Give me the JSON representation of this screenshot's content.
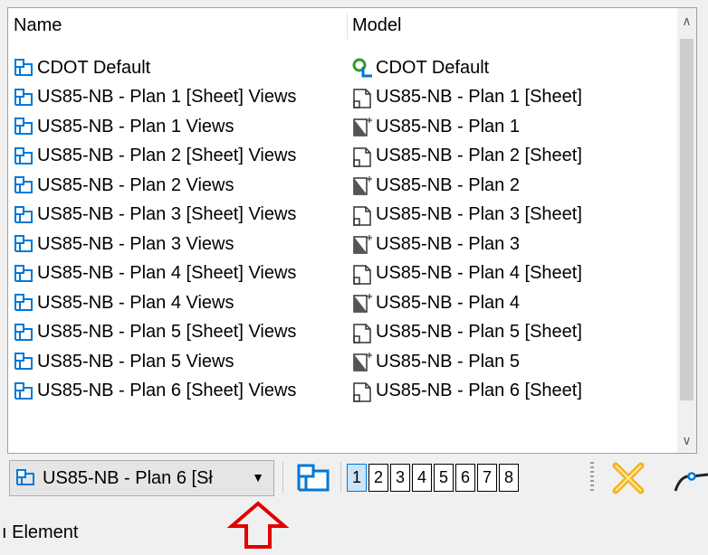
{
  "list": {
    "headers": {
      "name": "Name",
      "model": "Model"
    },
    "rows": [
      {
        "name": "CDOT Default",
        "model": "CDOT Default",
        "model_icon": "default-model-icon"
      },
      {
        "name": "US85-NB - Plan 1 [Sheet] Views",
        "model": "US85-NB - Plan 1 [Sheet]",
        "model_icon": "sheet-model-icon"
      },
      {
        "name": "US85-NB - Plan 1 Views",
        "model": "US85-NB - Plan 1",
        "model_icon": "design-model-icon"
      },
      {
        "name": "US85-NB - Plan 2 [Sheet] Views",
        "model": "US85-NB - Plan 2 [Sheet]",
        "model_icon": "sheet-model-icon"
      },
      {
        "name": "US85-NB - Plan 2 Views",
        "model": "US85-NB - Plan 2",
        "model_icon": "design-model-icon"
      },
      {
        "name": "US85-NB - Plan 3 [Sheet] Views",
        "model": "US85-NB - Plan 3 [Sheet]",
        "model_icon": "sheet-model-icon"
      },
      {
        "name": "US85-NB - Plan 3 Views",
        "model": "US85-NB - Plan 3",
        "model_icon": "design-model-icon"
      },
      {
        "name": "US85-NB - Plan 4 [Sheet] Views",
        "model": "US85-NB - Plan 4 [Sheet]",
        "model_icon": "sheet-model-icon"
      },
      {
        "name": "US85-NB - Plan 4 Views",
        "model": "US85-NB - Plan 4",
        "model_icon": "design-model-icon"
      },
      {
        "name": "US85-NB - Plan 5 [Sheet] Views",
        "model": "US85-NB - Plan 5 [Sheet]",
        "model_icon": "sheet-model-icon"
      },
      {
        "name": "US85-NB - Plan 5 Views",
        "model": "US85-NB - Plan 5",
        "model_icon": "design-model-icon"
      },
      {
        "name": "US85-NB - Plan 6 [Sheet] Views",
        "model": "US85-NB - Plan 6 [Sheet]",
        "model_icon": "sheet-model-icon"
      }
    ],
    "name_icon": "saved-view-icon"
  },
  "scrollbar": {
    "up_glyph": "∧",
    "down_glyph": "∨"
  },
  "toolbar": {
    "view_combo_value": "US85-NB - Plan 6 [Sł",
    "view_combo_arrow": "▼",
    "view_numbers": [
      "1",
      "2",
      "3",
      "4",
      "5",
      "6",
      "7",
      "8"
    ],
    "active_view": "1"
  },
  "status": {
    "text": "ı Element"
  },
  "colors": {
    "accent_blue": "#0078d7",
    "icon_green": "#2e9e2e",
    "annotation_red": "#e00000"
  }
}
